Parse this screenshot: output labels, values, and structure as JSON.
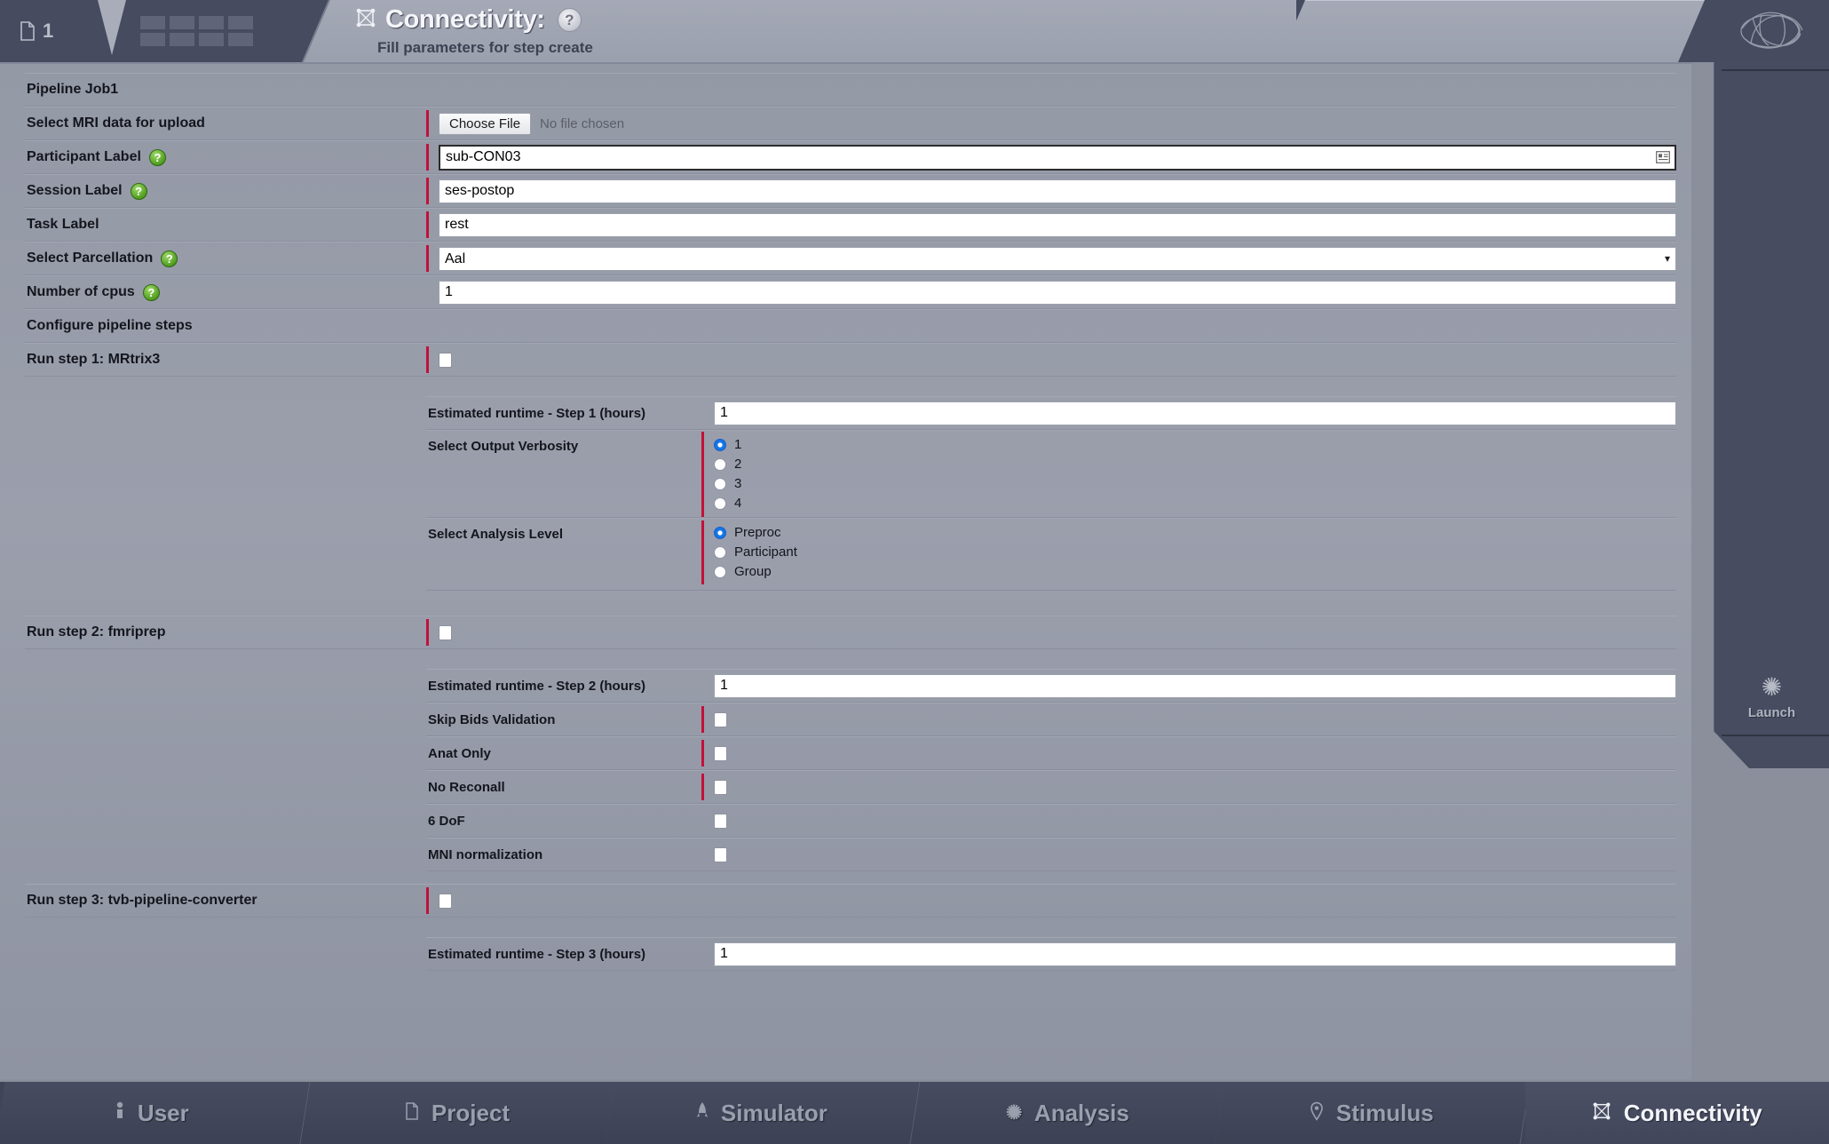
{
  "header": {
    "doc_count": "1",
    "title": "Connectivity:",
    "subtitle": "Fill parameters for step create",
    "help_symbol": "?",
    "conn_icon": "connectivity-icon",
    "grid_icon": "grid-menu-icon",
    "brain_icon": "brain-logo-icon"
  },
  "sidebar": {
    "launch_label": "Launch",
    "launch_icon": "gear-icon"
  },
  "form": {
    "job_title": "Pipeline Job1",
    "fields": {
      "mri_upload_label": "Select MRI data for upload",
      "choose_file_button": "Choose File",
      "no_file_chosen": "No file chosen",
      "participant_label": "Participant Label",
      "participant_value": "sub-CON03",
      "session_label": "Session Label",
      "session_value": "ses-postop",
      "task_label": "Task Label",
      "task_value": "rest",
      "parcellation_label": "Select Parcellation",
      "parcellation_value": "Aal",
      "parcellation_options": [
        "Aal"
      ],
      "cpus_label": "Number of cpus",
      "cpus_value": "1"
    },
    "configure_header": "Configure pipeline steps",
    "step1": {
      "label": "Run step 1: MRtrix3",
      "checked": false,
      "runtime_label": "Estimated runtime - Step 1 (hours)",
      "runtime_value": "1",
      "verbosity_label": "Select Output Verbosity",
      "verbosity_options": [
        "1",
        "2",
        "3",
        "4"
      ],
      "verbosity_selected": "1",
      "analysis_label": "Select Analysis Level",
      "analysis_options": [
        "Preproc",
        "Participant",
        "Group"
      ],
      "analysis_selected": "Preproc"
    },
    "step2": {
      "label": "Run step 2: fmriprep",
      "checked": false,
      "runtime_label": "Estimated runtime - Step 2 (hours)",
      "runtime_value": "1",
      "options": [
        {
          "label": "Skip Bids Validation",
          "checked": false,
          "required": true
        },
        {
          "label": "Anat Only",
          "checked": false,
          "required": true
        },
        {
          "label": "No Reconall",
          "checked": false,
          "required": true
        },
        {
          "label": "6 DoF",
          "checked": false,
          "required": false
        },
        {
          "label": "MNI normalization",
          "checked": false,
          "required": false
        }
      ]
    },
    "step3": {
      "label": "Run step 3: tvb-pipeline-converter",
      "checked": false,
      "runtime_label": "Estimated runtime - Step 3 (hours)",
      "runtime_value": "1"
    }
  },
  "bottom_nav": [
    {
      "label": "User",
      "icon": "user-icon",
      "active": false
    },
    {
      "label": "Project",
      "icon": "document-icon",
      "active": false
    },
    {
      "label": "Simulator",
      "icon": "rocket-icon",
      "active": false
    },
    {
      "label": "Analysis",
      "icon": "asterisk-icon",
      "active": false
    },
    {
      "label": "Stimulus",
      "icon": "pin-icon",
      "active": false
    },
    {
      "label": "Connectivity",
      "icon": "connectivity-icon",
      "active": true
    }
  ],
  "colors": {
    "required_marker": "#c2103a",
    "help_badge_green": "#4e9c1e",
    "radio_selected_blue": "#1675e8",
    "panel_bg": "#9b9fac",
    "chrome_bg": "#464b60"
  }
}
